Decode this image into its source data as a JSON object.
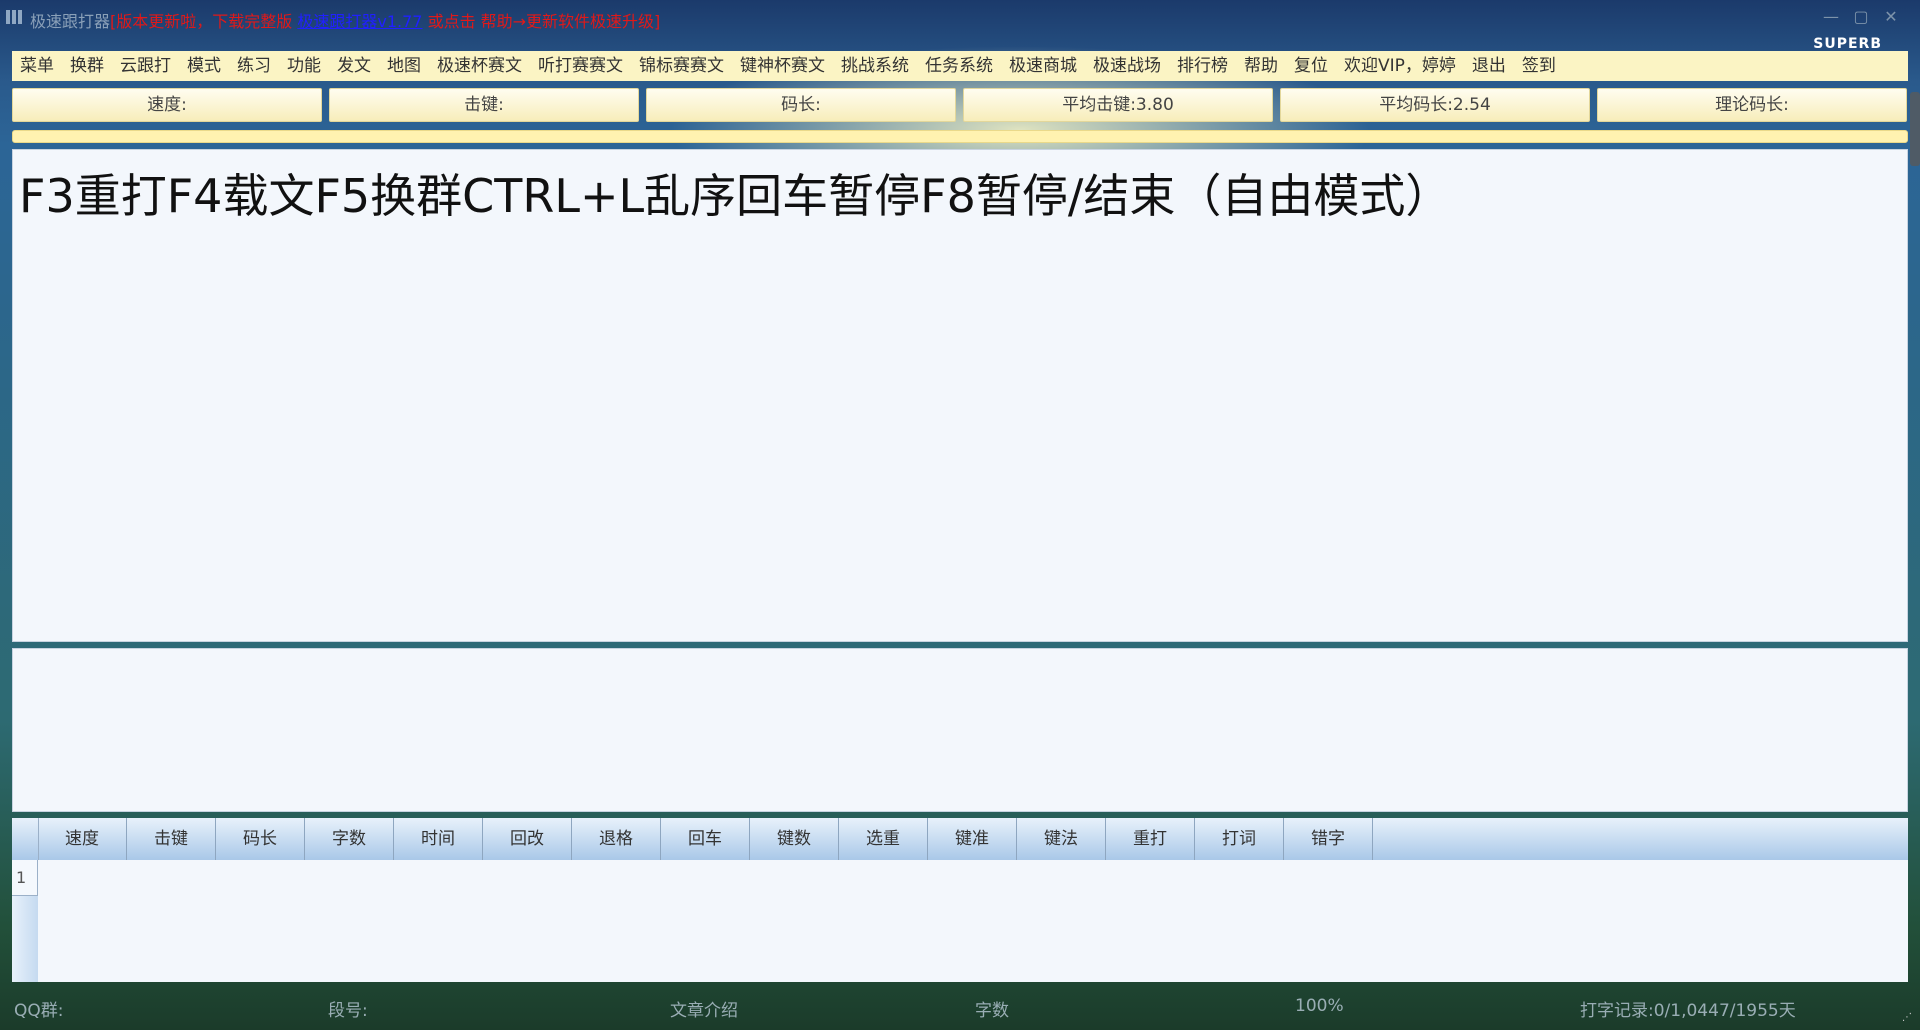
{
  "titlebar": {
    "app_name": "极速跟打器",
    "notice_red": "[版本更新啦，下载完整版",
    "link": "极速跟打器v1.77",
    "notice_tail": "或点击 帮助→更新软件极速升级]",
    "minimize": "—",
    "maximize": "▢",
    "close": "✕",
    "brand": "SUPERB"
  },
  "menu": {
    "items": [
      "菜单",
      "换群",
      "云跟打",
      "模式",
      "练习",
      "功能",
      "发文",
      "地图",
      "极速杯赛文",
      "听打赛赛文",
      "锦标赛赛文",
      "键神杯赛文",
      "挑战系统",
      "任务系统",
      "极速商城",
      "极速战场",
      "排行榜",
      "帮助",
      "复位",
      "欢迎VIP，婷婷",
      "退出",
      "签到"
    ]
  },
  "stats": {
    "speed": "速度:",
    "keystroke": "击键:",
    "code_length": "码长:",
    "avg_keystroke": "平均击键:3.80",
    "avg_code_length": "平均码长:2.54",
    "theory_code_length": "理论码长:"
  },
  "main_text": "F3重打F4载文F5换群CTRL+L乱序回车暂停F8暂停/结束（自由模式）",
  "grid": {
    "columns": [
      "速度",
      "击键",
      "码长",
      "字数",
      "时间",
      "回改",
      "退格",
      "回车",
      "键数",
      "选重",
      "键准",
      "键法",
      "重打",
      "打词",
      "错字"
    ],
    "rows": [
      "1"
    ]
  },
  "status": {
    "qq": "QQ群:",
    "segment": "段号:",
    "article": "文章介绍",
    "count": "字数",
    "accuracy": "100%",
    "record": "打字记录:0/1,0447/1955天"
  }
}
